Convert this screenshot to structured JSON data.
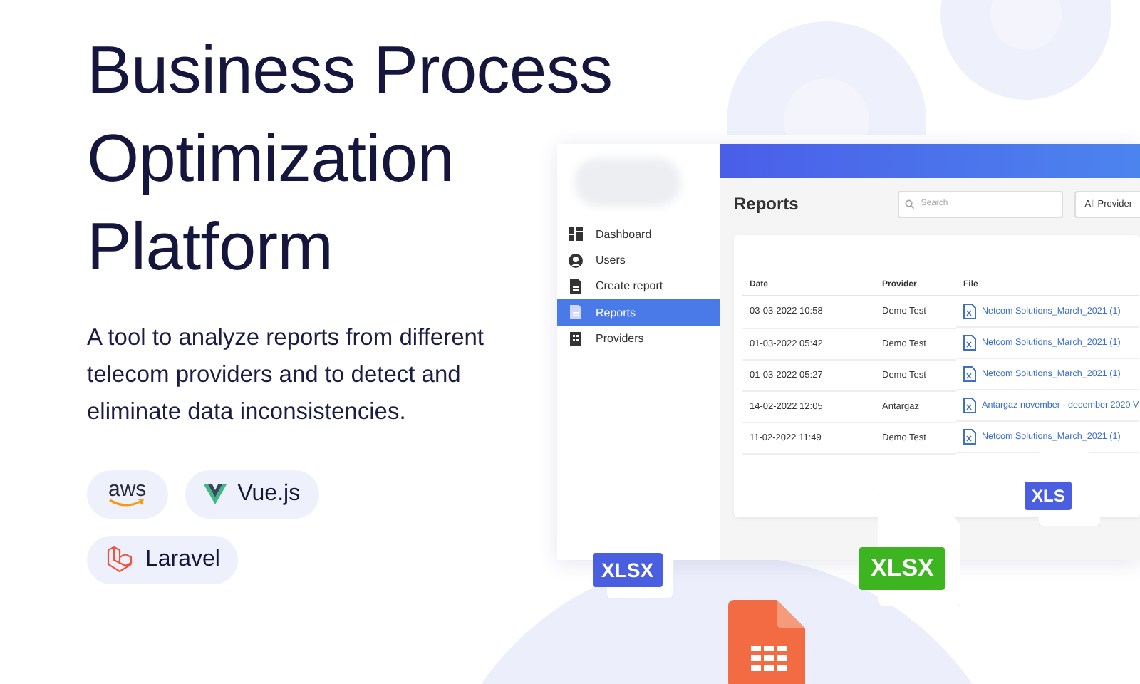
{
  "hero": {
    "title_lines": [
      "Business Process",
      "Optimization",
      "Platform"
    ],
    "description": "A tool to analyze reports from different telecom providers and to detect and eliminate data inconsistencies."
  },
  "tech_badges": [
    {
      "kind": "aws",
      "label": "aws"
    },
    {
      "kind": "vue",
      "label": "Vue.js"
    },
    {
      "kind": "laravel",
      "label": "Laravel"
    }
  ],
  "app": {
    "sidebar": {
      "items": [
        {
          "kind": "dashboard",
          "label": "Dashboard",
          "selected": false
        },
        {
          "kind": "users",
          "label": "Users",
          "selected": false
        },
        {
          "kind": "create",
          "label": "Create report",
          "selected": false
        },
        {
          "kind": "reports",
          "label": "Reports",
          "selected": true
        },
        {
          "kind": "providers",
          "label": "Providers",
          "selected": false
        }
      ]
    },
    "page_title": "Reports",
    "search": {
      "placeholder": "Search"
    },
    "provider_filter": {
      "value": "All Provider"
    },
    "table": {
      "columns": [
        "Date",
        "Provider",
        "File"
      ],
      "rows": [
        [
          "03-03-2022 10:58",
          "Demo Test",
          "Netcom Solutions_March_2021 (1)"
        ],
        [
          "01-03-2022 05:42",
          "Demo Test",
          "Netcom Solutions_March_2021 (1)"
        ],
        [
          "01-03-2022 05:27",
          "Demo Test",
          "Netcom Solutions_March_2021 (1)"
        ],
        [
          "14-02-2022 12:05",
          "Antargaz",
          "Antargaz november - december 2020 V"
        ],
        [
          "11-02-2022 11:49",
          "Demo Test",
          "Netcom Solutions_March_2021 (1)"
        ]
      ]
    }
  },
  "floating_files": [
    {
      "kind": "tag",
      "label": "XLSX",
      "color": "#4a5ee0"
    },
    {
      "kind": "tag",
      "label": "XLSX",
      "color": "#3cb521"
    },
    {
      "kind": "tag",
      "label": "XLS",
      "color": "#4a5ee0"
    },
    {
      "kind": "sheet"
    }
  ]
}
